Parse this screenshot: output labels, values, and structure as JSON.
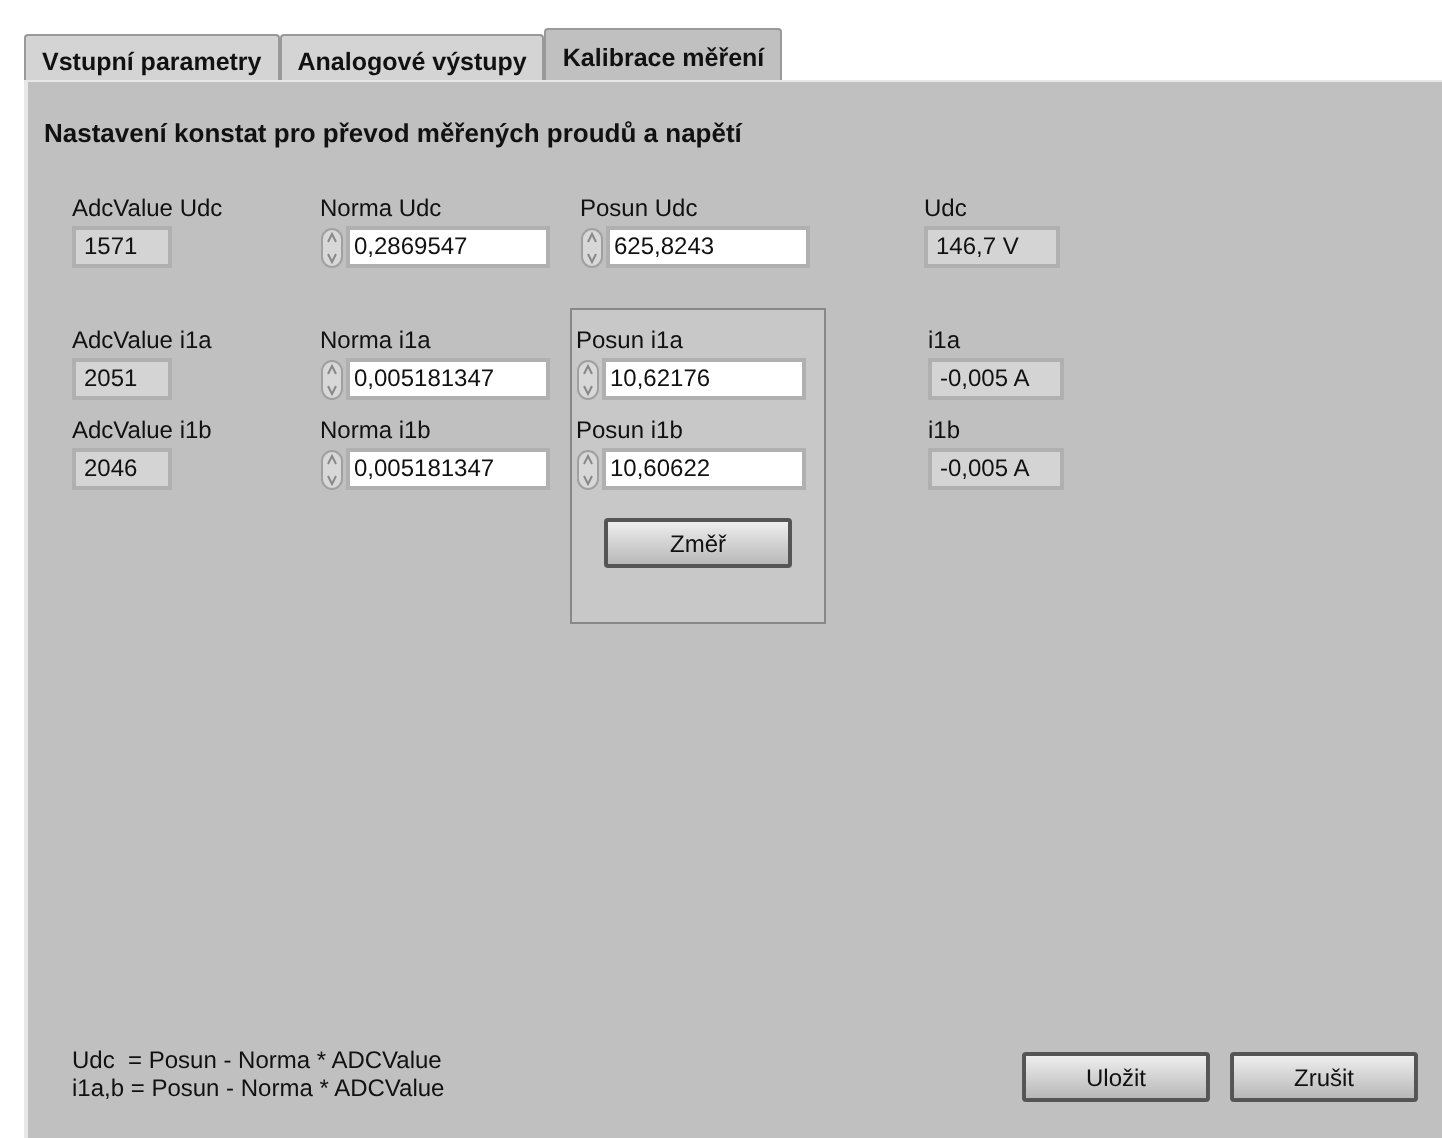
{
  "tabs": [
    {
      "label": "Vstupní parametry",
      "selected": false
    },
    {
      "label": "Analogové výstupy",
      "selected": false
    },
    {
      "label": "Kalibrace měření",
      "selected": true
    }
  ],
  "heading": "Nastavení konstat pro převod měřených proudů a napětí",
  "voltage": {
    "adc": {
      "label": "AdcValue Udc",
      "value": "1571"
    },
    "norma": {
      "label": "Norma Udc",
      "value": "0,2869547"
    },
    "posun": {
      "label": "Posun Udc",
      "value": "625,8243"
    },
    "result": {
      "label": "Udc",
      "value": "146,7 V"
    }
  },
  "channels": [
    {
      "adc": {
        "label": "AdcValue i1a",
        "value": "2051"
      },
      "norma": {
        "label": "Norma i1a",
        "value": "0,005181347"
      },
      "posun": {
        "label": "Posun i1a",
        "value": "10,62176"
      },
      "result": {
        "label": "i1a",
        "value": "-0,005 A"
      }
    },
    {
      "adc": {
        "label": "AdcValue i1b",
        "value": "2046"
      },
      "norma": {
        "label": "Norma i1b",
        "value": "0,005181347"
      },
      "posun": {
        "label": "Posun i1b",
        "value": "10,60622"
      },
      "result": {
        "label": "i1b",
        "value": "-0,005 A"
      }
    }
  ],
  "measure_button": "Změř",
  "formulas": [
    "Udc  = Posun - Norma * ADCValue",
    "i1a,b = Posun - Norma * ADCValue"
  ],
  "buttons": [
    "Uložit",
    "Zrušit"
  ]
}
